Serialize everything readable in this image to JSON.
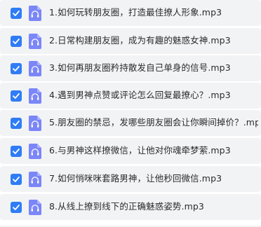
{
  "colors": {
    "row_background": "#f2f3f5",
    "checkbox_checked": "#2f7cf6",
    "audio_icon_bg": "#7b86f8",
    "text": "#2b2b2b"
  },
  "files": [
    {
      "name": "1.如何玩转朋友圈，打造最佳撩人形象.mp3",
      "checked": true,
      "icon": "headphones-icon"
    },
    {
      "name": "2.日常构建朋友圈，成为有趣的魅惑女神.mp3",
      "checked": true,
      "icon": "headphones-icon"
    },
    {
      "name": "3.如何再朋友圈矜持散发自己单身的信号.mp3",
      "checked": true,
      "icon": "headphones-icon"
    },
    {
      "name": "4.遇到男神点赞或评论怎么回复最撩心？.mp3",
      "checked": true,
      "icon": "headphones-icon"
    },
    {
      "name": "5.朋友圈的禁忌，发哪些朋友圈会让你瞬间掉价？.mp3",
      "checked": true,
      "icon": "headphones-icon"
    },
    {
      "name": "6.与男神这样撩微信，让他对你魂牵梦萦.mp3",
      "checked": true,
      "icon": "headphones-icon"
    },
    {
      "name": "7.如何悄咪咪套路男神，让他秒回微信.mp3",
      "checked": true,
      "icon": "headphones-icon"
    },
    {
      "name": "8.从线上撩到线下的正确魅惑姿势.mp3",
      "checked": true,
      "icon": "headphones-icon"
    }
  ]
}
